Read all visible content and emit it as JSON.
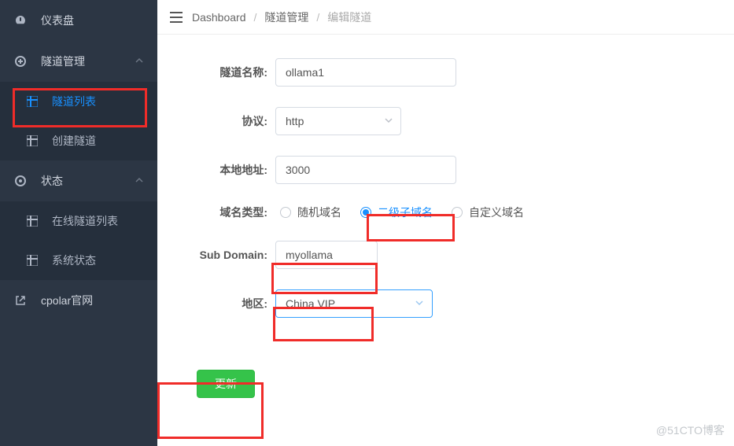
{
  "sidebar": {
    "dashboard": "仪表盘",
    "tunnel_mgmt": "隧道管理",
    "tunnel_list": "隧道列表",
    "create_tunnel": "创建隧道",
    "status": "状态",
    "online_list": "在线隧道列表",
    "system_status": "系统状态",
    "cpolar_site": "cpolar官网"
  },
  "breadcrumb": {
    "b1": "Dashboard",
    "b2": "隧道管理",
    "b3": "编辑隧道"
  },
  "form": {
    "name_label": "隧道名称:",
    "name_value": "ollama1",
    "proto_label": "协议:",
    "proto_value": "http",
    "local_label": "本地地址:",
    "local_value": "3000",
    "domtype_label": "域名类型:",
    "radio_random": "随机域名",
    "radio_sub": "二级子域名",
    "radio_custom": "自定义域名",
    "subdomain_label": "Sub Domain:",
    "subdomain_value": "myollama",
    "region_label": "地区:",
    "region_value": "China VIP",
    "submit": "更新"
  },
  "watermark": "@51CTO博客"
}
